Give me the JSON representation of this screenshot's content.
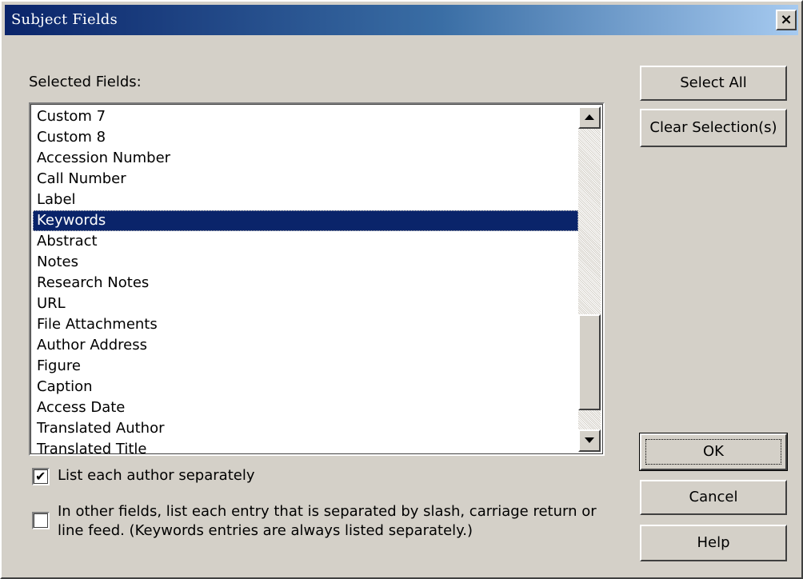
{
  "window": {
    "title": "Subject Fields",
    "close_glyph": "×",
    "close_icon": "close-x-icon"
  },
  "selected_fields": {
    "label": "Selected Fields:",
    "items": [
      "Custom 7",
      "Custom 8",
      "Accession Number",
      "Call Number",
      "Label",
      "Keywords",
      "Abstract",
      "Notes",
      "Research Notes",
      "URL",
      "File Attachments",
      "Author Address",
      "Figure",
      "Caption",
      "Access Date",
      "Translated Author",
      "Translated Title"
    ],
    "selected_item": "Keywords"
  },
  "buttons": {
    "select_all": "Select All",
    "clear_selection": "Clear Selection(s)",
    "ok": "OK",
    "cancel": "Cancel",
    "help": "Help"
  },
  "options": {
    "list_authors": {
      "label": "List each author separately",
      "checked": true
    },
    "list_entries": {
      "label": "In other fields, list each entry that is separated by slash, carriage return or line feed. (Keywords entries are always listed separately.)",
      "checked": false
    }
  },
  "colors": {
    "title_bar": "#0a246a",
    "selection_bg": "#0a246a",
    "selection_fg": "#ffffff",
    "face": "#d4d0c8"
  }
}
